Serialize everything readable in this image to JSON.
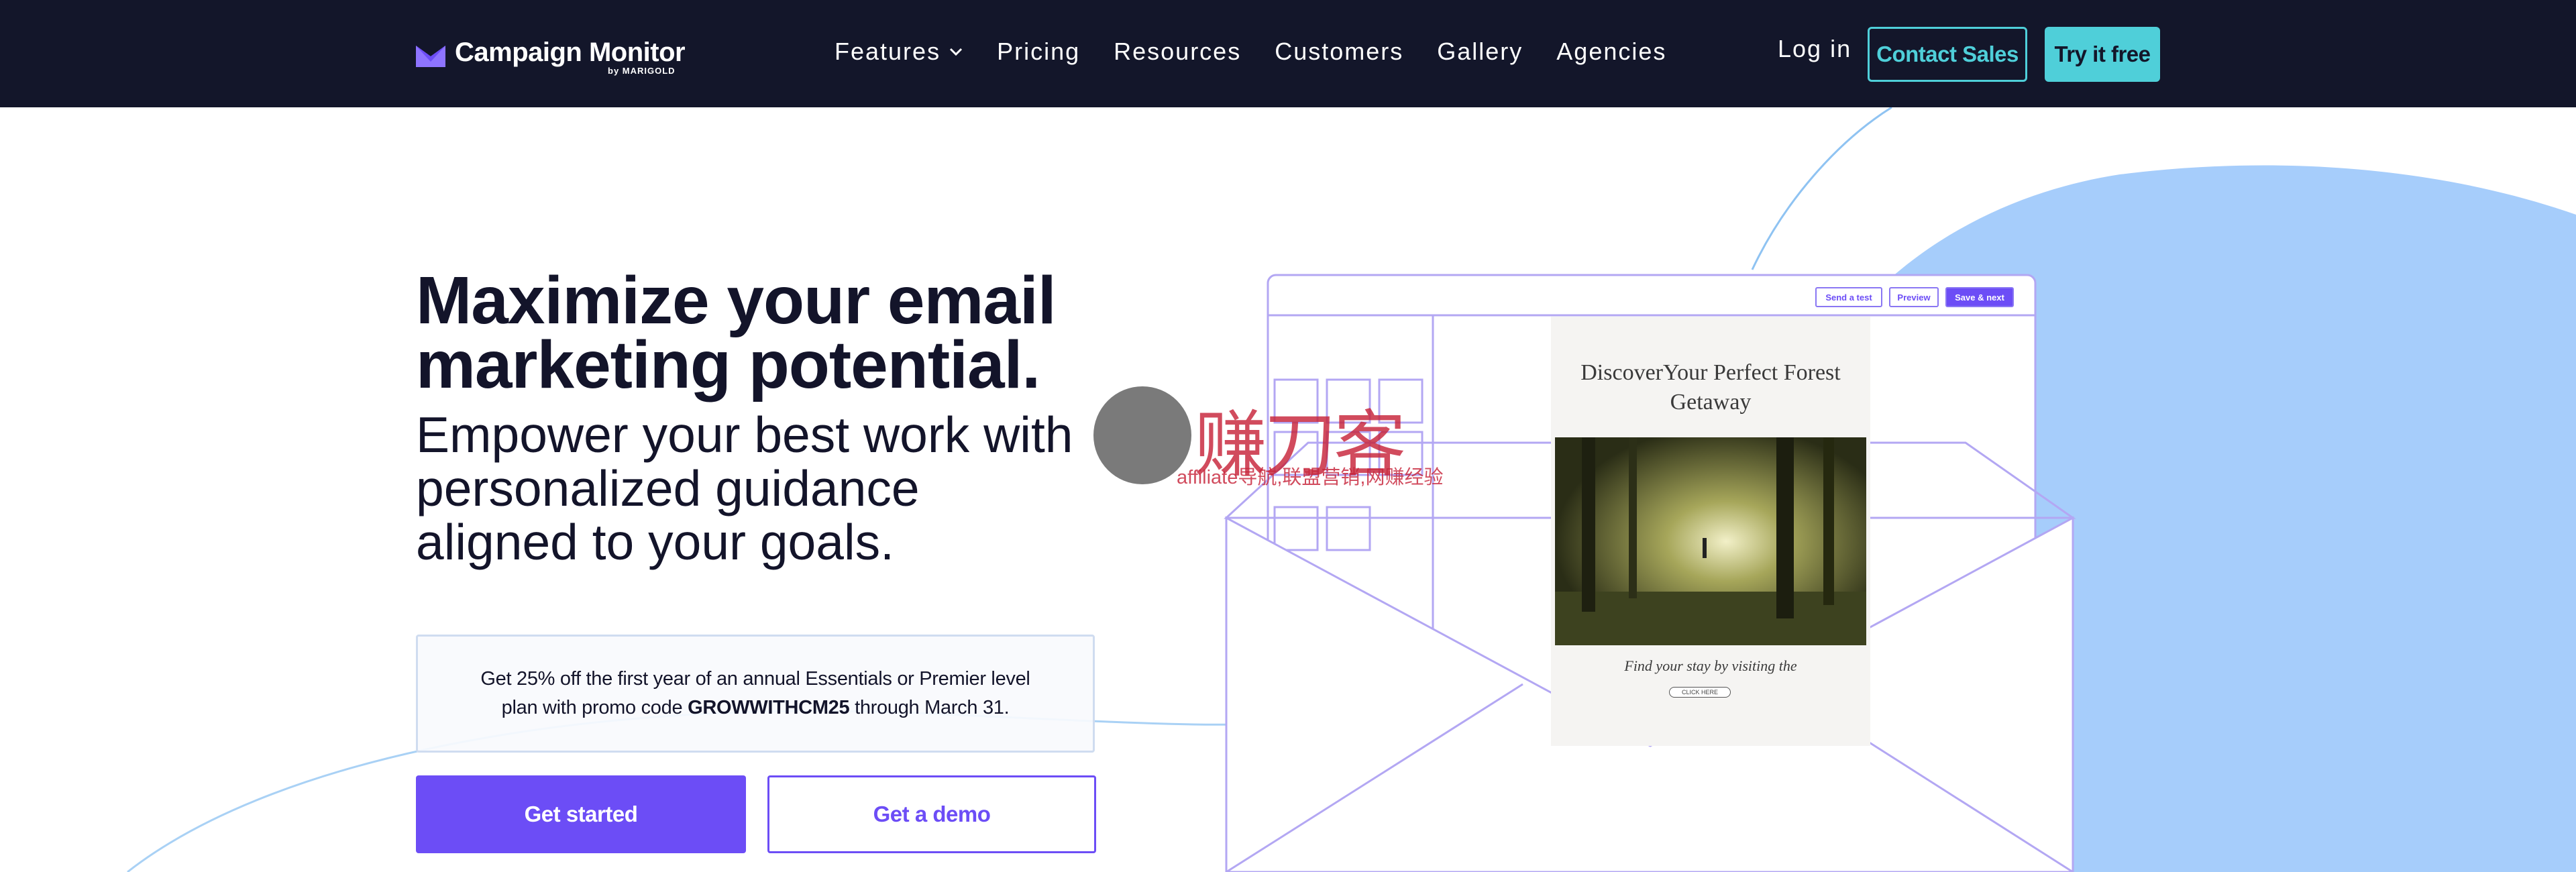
{
  "nav": {
    "logo_text": "Campaign Monitor",
    "logo_sub": "by MARIGOLD",
    "links": [
      "Features",
      "Pricing",
      "Resources",
      "Customers",
      "Gallery",
      "Agencies"
    ],
    "login": "Log in",
    "contact_sales": "Contact Sales",
    "try_free": "Try it free"
  },
  "hero": {
    "headline": "Maximize your email marketing potential.",
    "subline": "Empower your best work with personalized guidance aligned to your goals.",
    "promo_prefix": "Get 25% off the first year of an annual Essentials or Premier level plan with promo code ",
    "promo_code": "GROWWITHCM25",
    "promo_suffix": " through March 31.",
    "get_started": "Get started",
    "get_demo": "Get a demo"
  },
  "illustration": {
    "send_test": "Send a test",
    "preview": "Preview",
    "save_next": "Save & next",
    "email_title": "DiscoverYour Perfect Forest Getaway",
    "email_footer": "Find your stay by visiting the",
    "email_cta": "CLICK HERE"
  },
  "watermark": {
    "main": "赚刀客",
    "sub": "affiliate导航,联盟营销,网赚经验"
  },
  "colors": {
    "nav_bg": "#13162a",
    "accent_teal": "#4fcfd9",
    "primary_purple": "#6c4df6",
    "blob_blue": "#a6cdfb"
  }
}
